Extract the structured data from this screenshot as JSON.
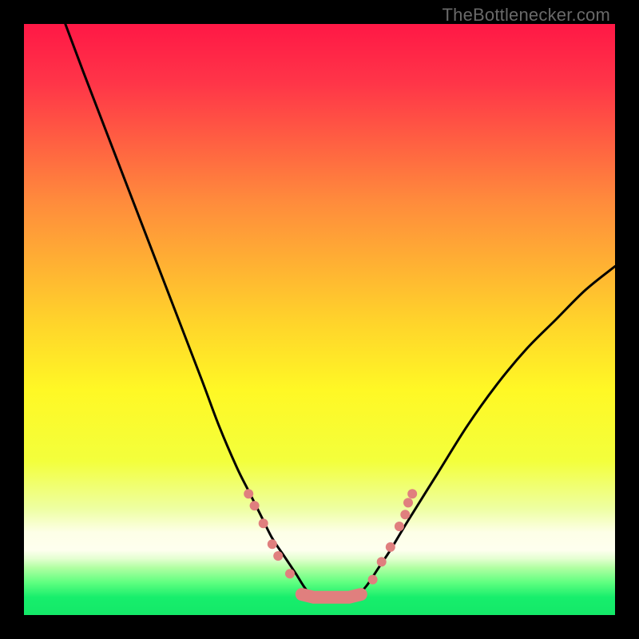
{
  "watermark": "TheBottlenecker.com",
  "gradient": {
    "stops": [
      {
        "offset": 0.0,
        "color": "#ff1846"
      },
      {
        "offset": 0.1,
        "color": "#ff3548"
      },
      {
        "offset": 0.3,
        "color": "#ff8b3c"
      },
      {
        "offset": 0.5,
        "color": "#ffd22b"
      },
      {
        "offset": 0.62,
        "color": "#fff825"
      },
      {
        "offset": 0.74,
        "color": "#f3ff3c"
      },
      {
        "offset": 0.82,
        "color": "#eeffa2"
      },
      {
        "offset": 0.86,
        "color": "#fdffe7"
      },
      {
        "offset": 0.89,
        "color": "#feffef"
      },
      {
        "offset": 0.905,
        "color": "#e3ffd0"
      },
      {
        "offset": 0.92,
        "color": "#b1ffa2"
      },
      {
        "offset": 0.945,
        "color": "#5fff80"
      },
      {
        "offset": 0.97,
        "color": "#17ee6c"
      },
      {
        "offset": 1.0,
        "color": "#14e868"
      }
    ]
  },
  "chart_data": {
    "type": "line",
    "title": "",
    "xlabel": "",
    "ylabel": "",
    "xlim": [
      0,
      100
    ],
    "ylim": [
      0,
      100
    ],
    "series": [
      {
        "name": "left-curve",
        "x": [
          7,
          10,
          15,
          20,
          25,
          30,
          33,
          36,
          38,
          40,
          42,
          44,
          46,
          48,
          50
        ],
        "y": [
          100,
          92,
          79,
          66,
          53,
          40,
          32,
          25,
          21,
          17,
          13,
          10,
          7,
          4,
          3
        ]
      },
      {
        "name": "valley-floor",
        "x": [
          50,
          52,
          54,
          56
        ],
        "y": [
          3,
          3,
          3,
          3
        ]
      },
      {
        "name": "right-curve",
        "x": [
          56,
          58,
          60,
          62,
          65,
          70,
          75,
          80,
          85,
          90,
          95,
          100
        ],
        "y": [
          3,
          5,
          8,
          11,
          16,
          24,
          32,
          39,
          45,
          50,
          55,
          59
        ]
      }
    ],
    "markers": {
      "name": "highlight-beads",
      "points_left": [
        [
          38,
          20.5
        ],
        [
          39,
          18.5
        ],
        [
          40.5,
          15.5
        ],
        [
          42,
          12
        ],
        [
          43,
          10
        ],
        [
          45,
          7
        ]
      ],
      "points_floor": [
        [
          47,
          3.5
        ],
        [
          49,
          3
        ],
        [
          51,
          3
        ],
        [
          53,
          3
        ],
        [
          55,
          3
        ],
        [
          57,
          3.5
        ]
      ],
      "points_right": [
        [
          59,
          6
        ],
        [
          60.5,
          9
        ],
        [
          62,
          11.5
        ],
        [
          63.5,
          15
        ],
        [
          64.5,
          17
        ],
        [
          65,
          19
        ],
        [
          65.7,
          20.5
        ]
      ],
      "color": "#e07f7e",
      "radii": {
        "small": 6,
        "floor": 8
      }
    }
  }
}
